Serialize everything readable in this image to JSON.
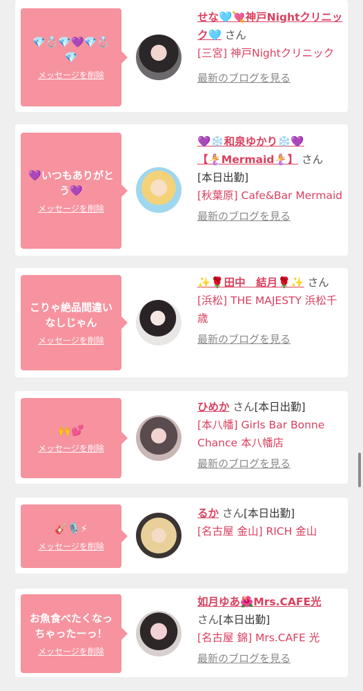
{
  "delete_label": "メッセージを削除",
  "blog_label": "最新のブログを見る",
  "san": "さん",
  "cards": [
    {
      "message": "💎💍💎💜💎💍💎",
      "name": "せな🩵💘神戸Nightクリニック🩵",
      "status": "",
      "shop": "[三宮] 神戸Nightクリニック"
    },
    {
      "message": "💜いつもありがとう💜",
      "name": "💜❄️和泉ゆかり❄️💜【🧜‍♀️Mermaid🧜‍♀️】",
      "status": "[本日出勤]",
      "shop": "[秋葉原] Cafe&Bar Mermaid"
    },
    {
      "message": "こりゃ絶品間違いなしじゃん",
      "name": "✨🌹田中　結月🌹✨",
      "status": "",
      "shop": "[浜松] THE MAJESTY 浜松千歳"
    },
    {
      "message": "🙌💕",
      "name": "ひめか",
      "status": "[本日出勤]",
      "shop": "[本八幡] Girls Bar Bonne Chance 本八幡店"
    },
    {
      "message": "🎸🎙️⚡",
      "name": "るか",
      "status": "[本日出勤]",
      "shop": "[名古屋 金山] RICH 金山"
    },
    {
      "message": "お魚食べたくなっちゃったーっ！",
      "name": "如月ゆあ🌺Mrs.CAFE光",
      "status": "[本日出勤]",
      "shop": "[名古屋 錦] Mrs.CAFE 光"
    }
  ]
}
